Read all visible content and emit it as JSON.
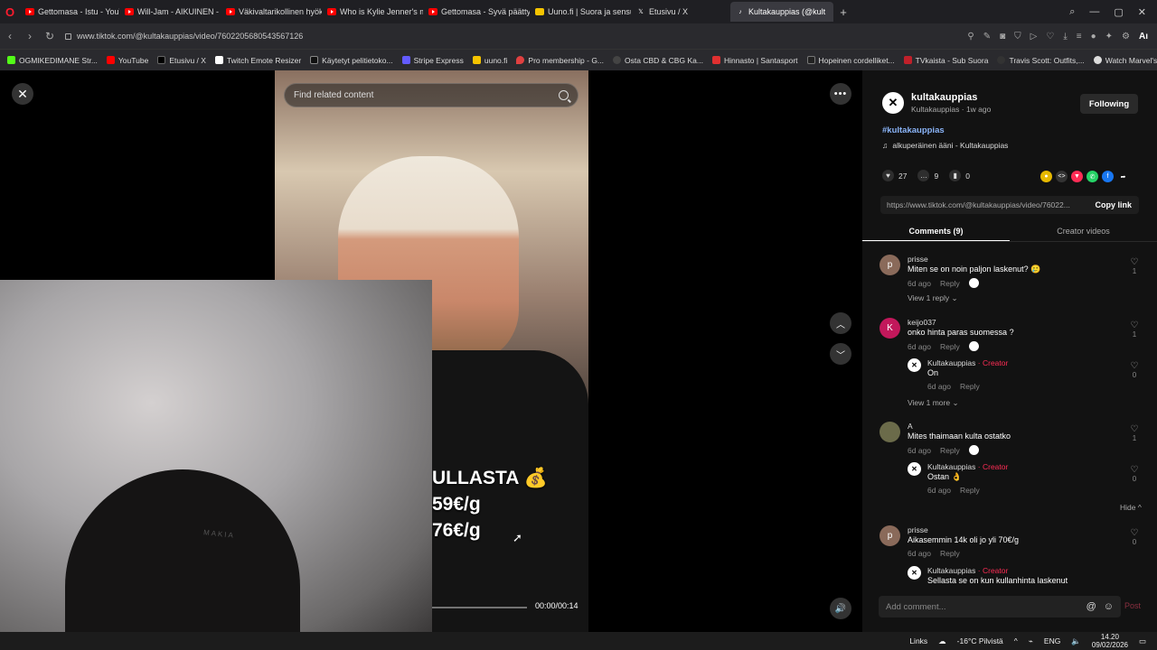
{
  "browser": {
    "tabs": [
      {
        "label": "Gettomasa - Istu - YouTub",
        "icon": "youtube-icon"
      },
      {
        "label": "Will-Jam - AIKUINEN - Yo",
        "icon": "youtube-icon"
      },
      {
        "label": "Väkivaltarikollinen hyökkä",
        "icon": "youtube-icon"
      },
      {
        "label": "Who is Kylie Jenner's mo",
        "icon": "youtube-icon"
      },
      {
        "label": "Gettomasa - Syvä päätty (",
        "icon": "youtube-icon"
      },
      {
        "label": "Uuno.fi | Suora ja sensuro",
        "icon": "uuno-icon"
      },
      {
        "label": "Etusivu / X",
        "icon": "x-icon"
      },
      {
        "label": "Kultakauppias (@kult",
        "icon": "tiktok-icon",
        "active": true
      }
    ],
    "url": "www.tiktok.com/@kultakauppias/video/7602205680543567126",
    "bookmarks": [
      {
        "label": "OGMIKEDIMANE Str...",
        "color": "#53fc18"
      },
      {
        "label": "YouTube",
        "color": "#ff0000"
      },
      {
        "label": "Etusivu / X",
        "color": "#000000"
      },
      {
        "label": "Twitch Emote Resizer",
        "color": "#ffffff"
      },
      {
        "label": "Käytetyt pelitietoko...",
        "color": "#111111"
      },
      {
        "label": "Stripe Express",
        "color": "#635bff"
      },
      {
        "label": "uuno.fi",
        "color": "#f5c400"
      },
      {
        "label": "Pro membership - G...",
        "color": "#e04040"
      },
      {
        "label": "Osta CBD & CBG Ka...",
        "color": "#444444"
      },
      {
        "label": "Hinnasto | Santasport",
        "color": "#e03030"
      },
      {
        "label": "Hopeinen cordelliket...",
        "color": "#222222"
      },
      {
        "label": "TVkaista - Sub Suora",
        "color": "#c0202a"
      },
      {
        "label": "Travis Scott: Outfits,...",
        "color": "#333333"
      },
      {
        "label": "Watch Marvel's Luk...",
        "color": "#dddddd"
      }
    ]
  },
  "video": {
    "search_placeholder": "Find related content",
    "overlay_line1": "ULLASTA 💰",
    "overlay_line2": "59€/g",
    "overlay_line3": "76€/g",
    "time": "00:00/00:14",
    "progress": 0.0,
    "webcam_hat_text": "MAKIA"
  },
  "panel": {
    "author_name": "kultakauppias",
    "author_sub": "Kultakauppias · 1w ago",
    "follow_label": "Following",
    "hashtag": "#kultakauppias",
    "music": "alkuperäinen ääni - Kultakauppias",
    "likes": "27",
    "comments_count": "9",
    "saves": "0",
    "link": "https://www.tiktok.com/@kultakauppias/video/76022...",
    "copy_label": "Copy link",
    "tab_comments": "Comments (9)",
    "tab_creator": "Creator videos",
    "input_placeholder": "Add comment...",
    "post_label": "Post"
  },
  "comments": [
    {
      "avatar": "p",
      "avatar_color": "#8a6a5a",
      "user": "prisse",
      "text": "Miten se on noin paljon laskenut? 🥲",
      "time": "6d ago",
      "reply": "Reply",
      "likes": "1",
      "view": "View 1 reply ⌄"
    },
    {
      "avatar": "K",
      "avatar_color": "#c2185b",
      "user": "keijo037",
      "text": "onko hinta paras suomessa ?",
      "time": "6d ago",
      "reply": "Reply",
      "likes": "1",
      "reply_item": {
        "user": "Kultakauppias",
        "tag": "· Creator",
        "text": "On",
        "time": "6d ago",
        "reply": "Reply",
        "likes": "0"
      },
      "view": "View 1 more ⌄"
    },
    {
      "avatar": "A",
      "avatar_color": "#6b6b4a",
      "user": "A",
      "text": "Mites thaimaan kulta ostatko",
      "time": "6d ago",
      "reply": "Reply",
      "likes": "1",
      "reply_item": {
        "user": "Kultakauppias",
        "tag": "· Creator",
        "text": "Ostan 👌",
        "time": "6d ago",
        "reply": "Reply",
        "likes": "0"
      },
      "hide": "Hide ^"
    },
    {
      "avatar": "p",
      "avatar_color": "#8a6a5a",
      "user": "prisse",
      "text": "Aikasemmin 14k oli jo yli 70€/g",
      "time": "6d ago",
      "reply": "Reply",
      "likes": "0",
      "reply_item": {
        "user": "Kultakauppias",
        "tag": "· Creator",
        "text": "Sellasta se on kun kullanhinta laskenut",
        "time": "",
        "reply": "",
        "likes": ""
      }
    }
  ],
  "taskbar": {
    "links": "Links",
    "weather": "-16°C Pilvistä",
    "lang": "ENG",
    "time": "14.20",
    "date": "09/02/2026"
  }
}
